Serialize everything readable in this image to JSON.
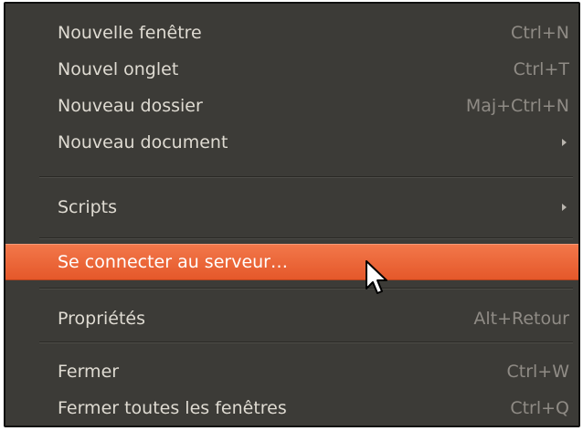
{
  "menu": {
    "items": [
      {
        "label": "Nouvelle fenêtre",
        "accel": "Ctrl+N"
      },
      {
        "label": "Nouvel onglet",
        "accel": "Ctrl+T"
      },
      {
        "label": "Nouveau dossier",
        "accel": "Maj+Ctrl+N"
      },
      {
        "label": "Nouveau document",
        "accel": "",
        "submenu_icon": "submenu-arrow-icon"
      },
      {
        "label": "Scripts",
        "accel": "",
        "submenu_icon": "submenu-arrow-icon"
      },
      {
        "label": "Se connecter au serveur…",
        "accel": "",
        "state": "highlighted"
      },
      {
        "label": "Propriétés",
        "accel": "Alt+Retour"
      },
      {
        "label": "Fermer",
        "accel": "Ctrl+W"
      },
      {
        "label": "Fermer toutes les fenêtres",
        "accel": "Ctrl+Q"
      }
    ]
  },
  "colors": {
    "menu_background": "#3c3b37",
    "menu_text": "#dfdbd2",
    "accelerator_text": "#8f8b85",
    "highlight": "#e9602f",
    "highlight_text": "#ffffff"
  },
  "pointer": {
    "icon": "mouse-pointer-icon"
  }
}
